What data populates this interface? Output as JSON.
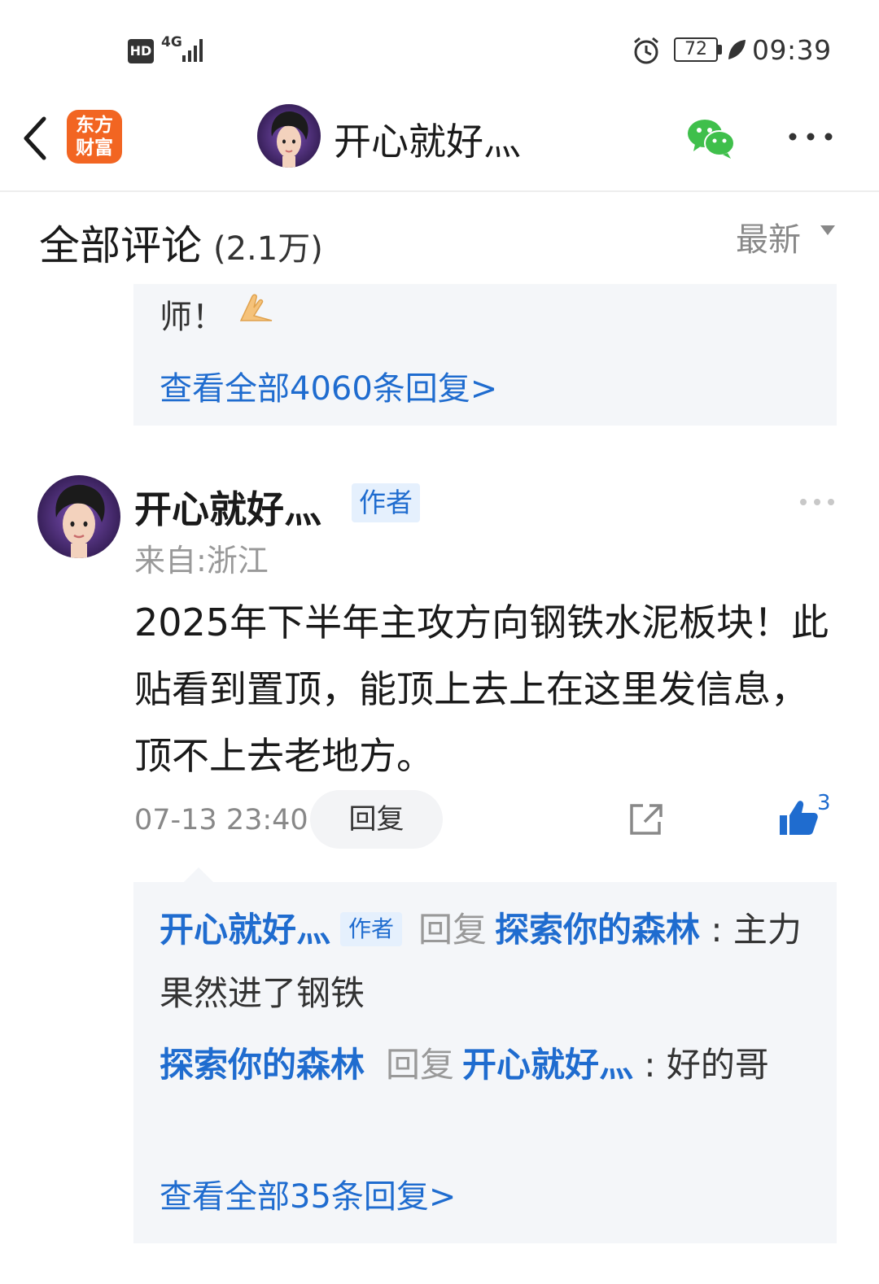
{
  "status_bar": {
    "hd": "HD",
    "network": "4G",
    "battery": "72",
    "time": "09:39"
  },
  "header": {
    "app_logo_line1": "东方",
    "app_logo_line2": "财富",
    "title": "开心就好灬",
    "icons": [
      "back-icon",
      "wechat-icon",
      "more-icon"
    ]
  },
  "comments_section": {
    "title": "全部评论",
    "count": "(2.1万)",
    "sort": "最新"
  },
  "previous_comment": {
    "tail_text": "师！",
    "emoji": "pray-hands",
    "view_all_replies": "查看全部4060条回复>"
  },
  "comment": {
    "author": "开心就好灬",
    "author_tag": "作者",
    "location": "来自:浙江",
    "body": "2025年下半年主攻方向钢铁水泥板块！此贴看到置顶，能顶上去上在这里发信息，顶不上去老地方。",
    "time": "07-13 23:40",
    "reply_label": "回复",
    "like_count": "3",
    "replies": [
      {
        "from": "开心就好灬",
        "tag": "作者",
        "verb": "回复",
        "to": "探索你的森林",
        "text": "主力果然进了钢铁"
      },
      {
        "from": "探索你的森林",
        "verb": "回复",
        "to": "开心就好灬",
        "text": "好的哥"
      }
    ],
    "view_all_replies": "查看全部35条回复>"
  },
  "colors": {
    "link_blue": "#1f6ccf",
    "app_orange": "#f26522",
    "reply_bg": "#f4f6f9",
    "wechat_green": "#3fbf4b"
  }
}
